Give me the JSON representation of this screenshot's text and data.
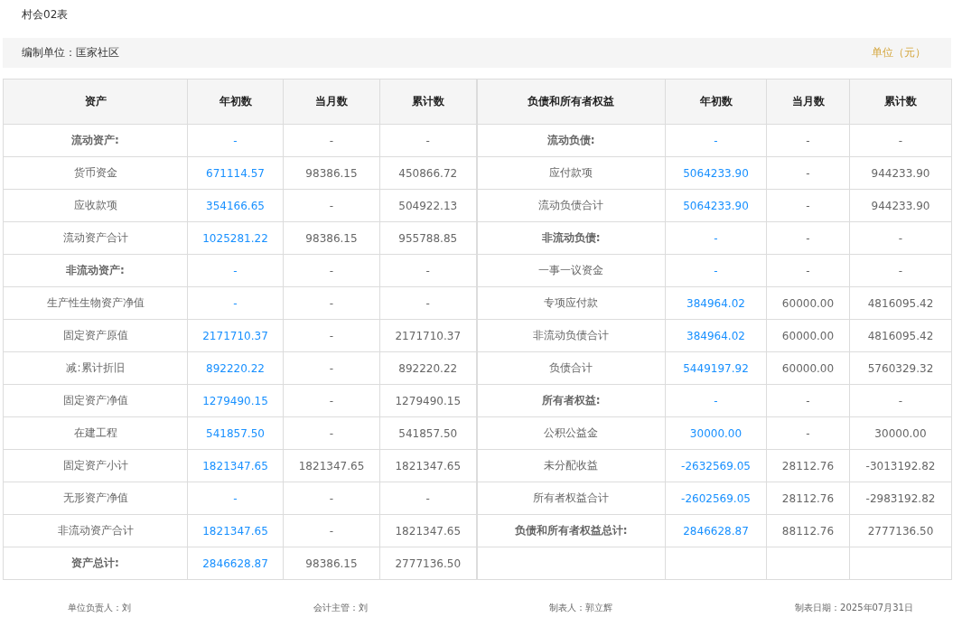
{
  "title": "村会02表",
  "info_bar": {
    "unit_label": "编制单位：匡家社区",
    "currency_note": "单位（元）"
  },
  "table": {
    "columns_left": [
      "资产",
      "年初数",
      "当月数",
      "累计数"
    ],
    "columns_right": [
      "负债和所有者权益",
      "年初数",
      "当月数",
      "累计数"
    ],
    "rows": [
      {
        "left": {
          "label": "流动资产:",
          "kind": "heading",
          "values": [
            "-",
            "-",
            "-"
          ]
        },
        "right": {
          "label": "流动负债:",
          "kind": "heading",
          "values": [
            "-",
            "-",
            "-"
          ]
        }
      },
      {
        "left": {
          "label": "货币资金",
          "kind": "item",
          "values": [
            "671114.57",
            "98386.15",
            "450866.72"
          ]
        },
        "right": {
          "label": "应付款项",
          "kind": "item",
          "values": [
            "5064233.90",
            "-",
            "944233.90"
          ]
        }
      },
      {
        "left": {
          "label": "应收款项",
          "kind": "item",
          "values": [
            "354166.65",
            "-",
            "504922.13"
          ]
        },
        "right": {
          "label": "流动负债合计",
          "kind": "item",
          "values": [
            "5064233.90",
            "-",
            "944233.90"
          ]
        }
      },
      {
        "left": {
          "label": "流动资产合计",
          "kind": "item",
          "values": [
            "1025281.22",
            "98386.15",
            "955788.85"
          ]
        },
        "right": {
          "label": "非流动负债:",
          "kind": "heading",
          "values": [
            "-",
            "-",
            "-"
          ]
        }
      },
      {
        "left": {
          "label": "非流动资产:",
          "kind": "heading",
          "values": [
            "-",
            "-",
            "-"
          ]
        },
        "right": {
          "label": "一事一议资金",
          "kind": "item",
          "values": [
            "-",
            "-",
            "-"
          ]
        }
      },
      {
        "left": {
          "label": "生产性生物资产净值",
          "kind": "item",
          "values": [
            "-",
            "-",
            "-"
          ]
        },
        "right": {
          "label": "专项应付款",
          "kind": "item",
          "values": [
            "384964.02",
            "60000.00",
            "4816095.42"
          ]
        }
      },
      {
        "left": {
          "label": "固定资产原值",
          "kind": "item",
          "values": [
            "2171710.37",
            "-",
            "2171710.37"
          ]
        },
        "right": {
          "label": "非流动负债合计",
          "kind": "item",
          "values": [
            "384964.02",
            "60000.00",
            "4816095.42"
          ]
        }
      },
      {
        "left": {
          "label": "减:累计折旧",
          "kind": "item",
          "values": [
            "892220.22",
            "-",
            "892220.22"
          ]
        },
        "right": {
          "label": "负债合计",
          "kind": "item",
          "values": [
            "5449197.92",
            "60000.00",
            "5760329.32"
          ]
        }
      },
      {
        "left": {
          "label": "固定资产净值",
          "kind": "item",
          "values": [
            "1279490.15",
            "-",
            "1279490.15"
          ]
        },
        "right": {
          "label": "所有者权益:",
          "kind": "heading",
          "values": [
            "-",
            "-",
            "-"
          ]
        }
      },
      {
        "left": {
          "label": "在建工程",
          "kind": "item",
          "values": [
            "541857.50",
            "-",
            "541857.50"
          ]
        },
        "right": {
          "label": "公积公益金",
          "kind": "item",
          "values": [
            "30000.00",
            "-",
            "30000.00"
          ]
        }
      },
      {
        "left": {
          "label": "固定资产小计",
          "kind": "item",
          "values": [
            "1821347.65",
            "1821347.65",
            "1821347.65"
          ]
        },
        "right": {
          "label": "未分配收益",
          "kind": "item",
          "values": [
            "-2632569.05",
            "28112.76",
            "-3013192.82"
          ]
        }
      },
      {
        "left": {
          "label": "无形资产净值",
          "kind": "item",
          "values": [
            "-",
            "-",
            "-"
          ]
        },
        "right": {
          "label": "所有者权益合计",
          "kind": "item",
          "values": [
            "-2602569.05",
            "28112.76",
            "-2983192.82"
          ]
        }
      },
      {
        "left": {
          "label": "非流动资产合计",
          "kind": "item",
          "values": [
            "1821347.65",
            "-",
            "1821347.65"
          ]
        },
        "right": {
          "label": "负债和所有者权益总计:",
          "kind": "heading",
          "values": [
            "2846628.87",
            "88112.76",
            "2777136.50"
          ]
        }
      },
      {
        "left": {
          "label": "资产总计:",
          "kind": "heading",
          "values": [
            "2846628.87",
            "98386.15",
            "2777136.50"
          ]
        }
      }
    ]
  },
  "footer": [
    "单位负责人：刘",
    "会计主管：刘",
    "制表人：郭立辉",
    "制表日期：2025年07月31日"
  ]
}
